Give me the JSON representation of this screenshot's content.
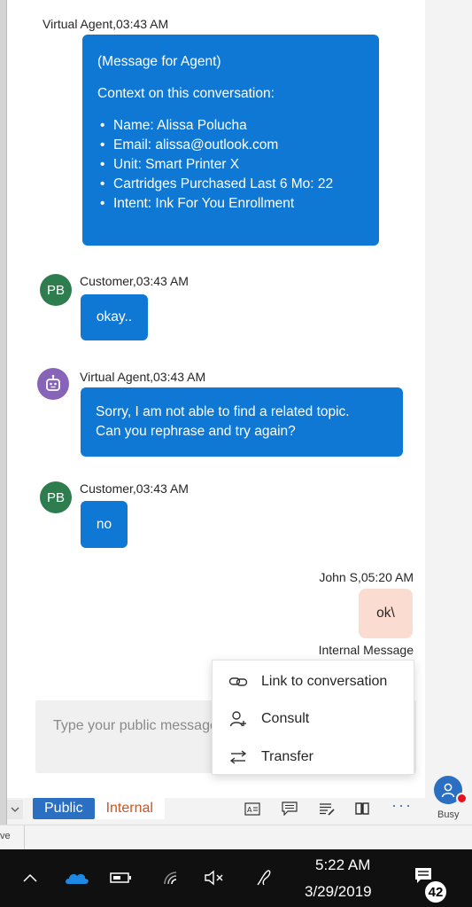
{
  "messages": [
    {
      "sender": "Virtual Agent,03:43 AM",
      "intro": "(Message for Agent)",
      "context_heading": "Context on this conversation:",
      "bullets": [
        "Name: Alissa Polucha",
        "Email: alissa@outlook.com",
        "Unit: Smart Printer X",
        "Cartridges Purchased Last 6 Mo: 22",
        "Intent: Ink For You Enrollment"
      ]
    },
    {
      "sender": "Customer,03:43 AM",
      "avatar": "PB",
      "text": "okay.."
    },
    {
      "sender": "Virtual Agent,03:43 AM",
      "avatar_icon": "bot-icon",
      "line1": "Sorry, I am not able to find a related topic.",
      "line2": "Can you rephrase and try again?"
    },
    {
      "sender": "Customer,03:43 AM",
      "avatar": "PB",
      "text": "no"
    },
    {
      "sender": "John S,05:20 AM",
      "text": "ok\\",
      "label": "Internal Message"
    }
  ],
  "composer": {
    "placeholder": "Type your public message"
  },
  "context_menu": [
    {
      "label": "Link to conversation",
      "icon": "link-icon"
    },
    {
      "label": "Consult",
      "icon": "consult-icon"
    },
    {
      "label": "Transfer",
      "icon": "transfer-icon"
    }
  ],
  "toolbar": {
    "tab_public": "Public",
    "tab_internal": "Internal",
    "more": "···",
    "icons": [
      "quick-replies-icon",
      "chat-icon",
      "notes-icon",
      "knowledge-base-icon"
    ]
  },
  "presence": {
    "status": "Busy"
  },
  "side_fragment": "ve",
  "taskbar": {
    "time": "5:22 AM",
    "date": "3/29/2019",
    "notification_count": "42",
    "icons": [
      "chevron-up-icon",
      "onedrive-icon",
      "battery-icon",
      "wifi-icon",
      "volume-mute-icon",
      "pen-icon",
      "action-center-icon"
    ]
  },
  "colors": {
    "bubble_blue": "#0f78d4",
    "internal_bubble": "#fbdcd0",
    "customer_avatar": "#2e7d4f",
    "bot_avatar": "#8764b8",
    "tab_public": "#2a6fc1",
    "tab_internal_text": "#d0521e",
    "busy_dot": "#e81123"
  }
}
